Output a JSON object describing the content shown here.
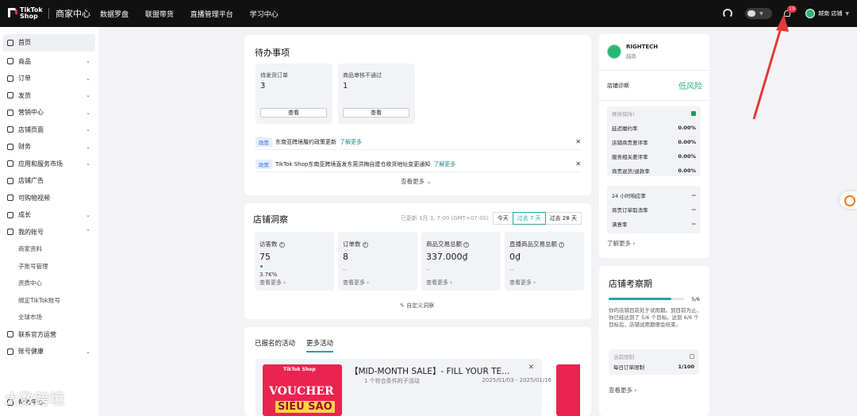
{
  "header": {
    "logo_text": "TikTok Shop",
    "brand": "商家中心",
    "nav": [
      "数据罗盘",
      "联盟带货",
      "直播管理平台",
      "学习中心"
    ],
    "notification_count": "19",
    "shop_name": "越南 店铺"
  },
  "sidebar": {
    "items": [
      {
        "label": "首页",
        "icon": "home-icon"
      },
      {
        "label": "商品",
        "icon": "box-icon"
      },
      {
        "label": "订单",
        "icon": "order-icon"
      },
      {
        "label": "发货",
        "icon": "truck-icon"
      },
      {
        "label": "营销中心",
        "icon": "megaphone-icon"
      },
      {
        "label": "店铺页面",
        "icon": "store-icon"
      },
      {
        "label": "财务",
        "icon": "wallet-icon"
      },
      {
        "label": "应用和服务市场",
        "icon": "apps-icon"
      },
      {
        "label": "店铺广告",
        "icon": "ad-icon"
      },
      {
        "label": "可购物视频",
        "icon": "video-icon"
      },
      {
        "label": "成长",
        "icon": "growth-icon"
      },
      {
        "label": "我的账号",
        "icon": "user-icon"
      }
    ],
    "account_sub": [
      "商家资料",
      "子账号管理",
      "资质中心",
      "绑定TikTok账号",
      "全球市场"
    ],
    "bottom": [
      {
        "label": "联系官方运营",
        "icon": "contact-icon"
      },
      {
        "label": "账号健康",
        "icon": "health-icon"
      },
      {
        "label": "帮助中心",
        "icon": "help-icon"
      }
    ]
  },
  "todo": {
    "title": "待办事项",
    "cards": [
      {
        "label": "待发货订单",
        "value": "3",
        "button": "查看"
      },
      {
        "label": "商品审核不通过",
        "value": "1",
        "button": "查看"
      }
    ],
    "notices": [
      {
        "tag": "政策",
        "text": "东南亚跨境履约政策更新",
        "link": "了解更多"
      },
      {
        "tag": "政策",
        "text": "TikTok Shop东南亚跨境直发东莞洪梅自建仓收货地址变更通知",
        "link": "了解更多"
      }
    ],
    "more": "查看更多"
  },
  "insights": {
    "title": "店铺洞察",
    "updated": "已更新 1月 3, 7:00 (GMT+07:00)",
    "ranges": [
      "今天",
      "过去 7 天",
      "过去 28 天"
    ],
    "metrics": [
      {
        "label": "访客数",
        "value": "75",
        "sub": "3.7K%",
        "more": "查看更多"
      },
      {
        "label": "订单数",
        "value": "8",
        "sub": "--",
        "more": "查看更多"
      },
      {
        "label": "商品交易总额",
        "value": "337.000₫",
        "sub": "--",
        "more": "查看更多"
      },
      {
        "label": "直播商品交易总额",
        "value": "0₫",
        "sub": "--",
        "more": "查看更多"
      }
    ],
    "custom": "自定义洞察"
  },
  "activities": {
    "tabs": [
      "已报名的活动",
      "更多活动"
    ],
    "promo": {
      "poster_brand": "TikTok Shop",
      "poster_line1": "VOUCHER",
      "poster_line2": "SIÊU SAO",
      "title": "【MID-MONTH SALE】- FILL YOUR TE...",
      "subtitle": "1 个符合条件的子活动",
      "dates": "2025/01/03 - 2025/01/16"
    }
  },
  "shop": {
    "name": "RIGHTECH",
    "region": "越南",
    "diag_label": "店铺诊断",
    "risk": "低风险",
    "group1_title": "继续保持!",
    "group1": [
      {
        "label": "延迟履约率",
        "value": "0.00%"
      },
      {
        "label": "店铺商责差评率",
        "value": "0.00%"
      },
      {
        "label": "服务相关差评率",
        "value": "0.00%"
      },
      {
        "label": "商责退货/退款率",
        "value": "0.00%"
      }
    ],
    "group2": [
      {
        "label": "24 小时响应率",
        "value": "--"
      },
      {
        "label": "商责订单取消率",
        "value": "--"
      },
      {
        "label": "满意率",
        "value": "--"
      }
    ],
    "more": "了解更多"
  },
  "observation": {
    "title": "店铺考察期",
    "progress": 0.833,
    "progress_text": "5/6",
    "desc": "你的店铺目前处于试用期。到目前为止，你已经达到了 5/6 个目标。达到 6/6 个目标后，店铺试用期便会结束。",
    "limit_label": "当前限制",
    "daily_label": "每日订单限制",
    "daily_value": "1/100",
    "more": "查看更多"
  },
  "watermark": "大数跨境",
  "colors": {
    "accent": "#28a3a3",
    "brand_pink": "#e9244f",
    "badge_red": "#e52d3c",
    "success": "#2bb673",
    "annotation_arrow": "#e53935"
  }
}
